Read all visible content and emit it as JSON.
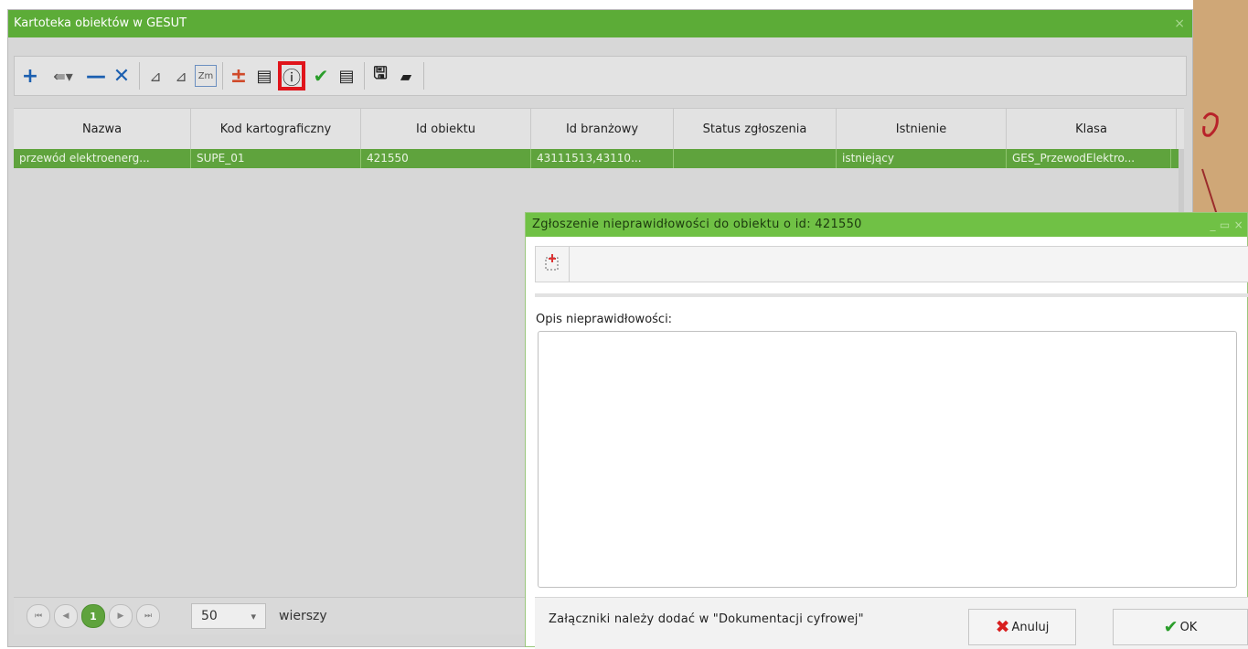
{
  "main_window": {
    "title": "Kartoteka obiektów w GESUT",
    "close_label": "×"
  },
  "toolbar": {
    "buttons": [
      {
        "name": "add",
        "glyph": "+"
      },
      {
        "name": "add-dropdown",
        "glyph": "⇚▾"
      },
      {
        "name": "remove",
        "glyph": "—"
      },
      {
        "name": "delete",
        "glyph": "✕"
      },
      {
        "name": "edit-geometry",
        "glyph": "⊿"
      },
      {
        "name": "edit-attributes",
        "glyph": "⊿"
      },
      {
        "name": "zoom",
        "glyph": "Zm"
      },
      {
        "name": "plus-minus",
        "glyph": "±"
      },
      {
        "name": "stack",
        "glyph": "▤"
      },
      {
        "name": "report-issue",
        "glyph": "ⓘ"
      },
      {
        "name": "accept",
        "glyph": "✔"
      },
      {
        "name": "list",
        "glyph": "▤"
      },
      {
        "name": "save",
        "glyph": "🖫"
      },
      {
        "name": "open-folder",
        "glyph": "▰"
      }
    ]
  },
  "grid": {
    "columns": [
      "Nazwa",
      "Kod kartograficzny",
      "Id obiektu",
      "Id branżowy",
      "Status zgłoszenia",
      "Istnienie",
      "Klasa"
    ],
    "rows": [
      [
        "przewód elektroenerg...",
        "SUPE_01",
        "421550",
        "43111513,43110...",
        "",
        "istniejący",
        "GES_PrzewodElektro..."
      ]
    ]
  },
  "pager": {
    "current_page": "1",
    "page_size": "50",
    "page_size_caret": "▾",
    "rows_label": "wierszy"
  },
  "dialog": {
    "title": "Zgłoszenie nieprawidłowości do obiektu o id: 421550",
    "window_controls": "_ ▭ ×",
    "description_label": "Opis nieprawidłowości:",
    "description_value": "",
    "attachments_note": "Załączniki należy dodać w \"Dokumentacji cyfrowej\"",
    "cancel_label": "Anuluj",
    "ok_label": "OK"
  },
  "colors": {
    "title_green": "#5cac37",
    "selection_green": "#5fa33d",
    "highlight_red": "#e0141b",
    "map_bg": "#cfa777"
  }
}
